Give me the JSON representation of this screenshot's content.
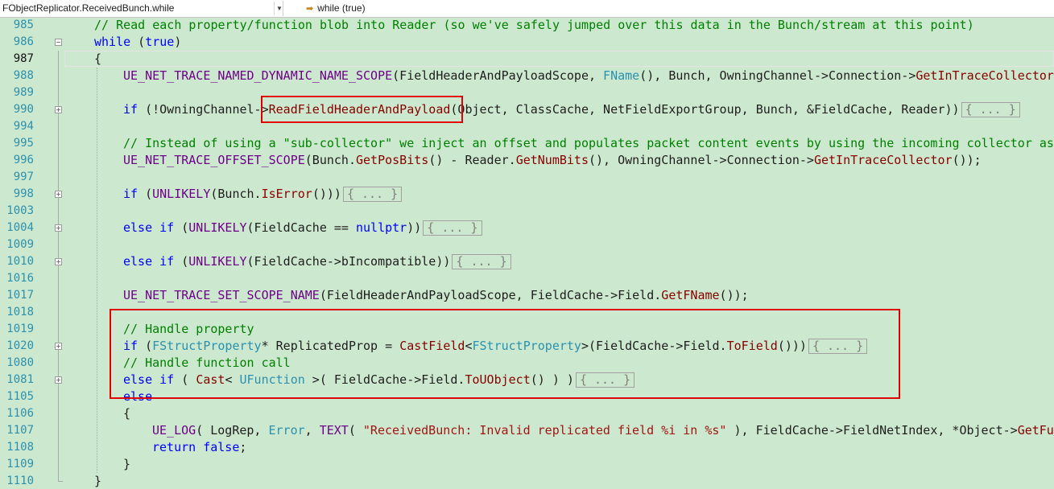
{
  "navigation": {
    "scope_label": "FObjectReplicator.ReceivedBunch.while",
    "member_label": "while (true)"
  },
  "colors": {
    "background": "#cce8cf",
    "line_number": "#2b91af",
    "keyword": "#0000ff",
    "comment": "#008000",
    "macro": "#6f008a",
    "function": "#880000",
    "type": "#2b91af",
    "string": "#a31515",
    "highlight_box": "#e00000"
  },
  "current_line": 987,
  "lines": [
    {
      "num": "985",
      "fold": "none",
      "indent": 0,
      "tokens": [
        {
          "t": "// Read each property/function blob into Reader (so we've safely jumped over this data in the Bunch/stream at this point)",
          "c": "cm"
        }
      ]
    },
    {
      "num": "986",
      "fold": "open",
      "indent": 0,
      "tokens": [
        {
          "t": "while",
          "c": "kw"
        },
        {
          "t": " ("
        },
        {
          "t": "true",
          "c": "kw"
        },
        {
          "t": ")"
        }
      ]
    },
    {
      "num": "987",
      "fold": "none",
      "indent": 0,
      "tokens": [
        {
          "t": "{"
        }
      ]
    },
    {
      "num": "988",
      "fold": "none",
      "indent": 1,
      "tokens": [
        {
          "t": "UE_NET_TRACE_NAMED_DYNAMIC_NAME_SCOPE",
          "c": "mac"
        },
        {
          "t": "(FieldHeaderAndPayloadScope, "
        },
        {
          "t": "FName",
          "c": "ty"
        },
        {
          "t": "(), Bunch, OwningChannel->Connection->"
        },
        {
          "t": "GetInTraceCollector",
          "c": "fn"
        },
        {
          "t": "()"
        }
      ]
    },
    {
      "num": "989",
      "fold": "none",
      "indent": 1,
      "tokens": []
    },
    {
      "num": "990",
      "fold": "closed",
      "indent": 1,
      "tokens": [
        {
          "t": "if",
          "c": "kw"
        },
        {
          "t": " (!OwningChannel->"
        },
        {
          "t": "ReadFieldHeaderAndPayload",
          "c": "fn"
        },
        {
          "t": "(Object, ClassCache, NetFieldExportGroup, Bunch, &FieldCache, Reader))"
        },
        {
          "t": "{ ... }",
          "c": "collapsed"
        }
      ]
    },
    {
      "num": "994",
      "fold": "none",
      "indent": 1,
      "tokens": []
    },
    {
      "num": "995",
      "fold": "none",
      "indent": 1,
      "tokens": [
        {
          "t": "// Instead of using a \"sub-collector\" we inject an offset and populates packet content events by using the incoming collector ass",
          "c": "cm"
        }
      ]
    },
    {
      "num": "996",
      "fold": "none",
      "indent": 1,
      "tokens": [
        {
          "t": "UE_NET_TRACE_OFFSET_SCOPE",
          "c": "mac"
        },
        {
          "t": "(Bunch."
        },
        {
          "t": "GetPosBits",
          "c": "fn"
        },
        {
          "t": "() - Reader."
        },
        {
          "t": "GetNumBits",
          "c": "fn"
        },
        {
          "t": "(), OwningChannel->Connection->"
        },
        {
          "t": "GetInTraceCollector",
          "c": "fn"
        },
        {
          "t": "());"
        }
      ]
    },
    {
      "num": "997",
      "fold": "none",
      "indent": 1,
      "tokens": []
    },
    {
      "num": "998",
      "fold": "closed",
      "indent": 1,
      "tokens": [
        {
          "t": "if",
          "c": "kw"
        },
        {
          "t": " ("
        },
        {
          "t": "UNLIKELY",
          "c": "mac"
        },
        {
          "t": "(Bunch."
        },
        {
          "t": "IsError",
          "c": "fn"
        },
        {
          "t": "()))"
        },
        {
          "t": "{ ... }",
          "c": "collapsed"
        }
      ]
    },
    {
      "num": "1003",
      "fold": "none",
      "indent": 1,
      "tokens": []
    },
    {
      "num": "1004",
      "fold": "closed",
      "indent": 1,
      "tokens": [
        {
          "t": "else",
          "c": "kw"
        },
        {
          "t": " "
        },
        {
          "t": "if",
          "c": "kw"
        },
        {
          "t": " ("
        },
        {
          "t": "UNLIKELY",
          "c": "mac"
        },
        {
          "t": "(FieldCache == "
        },
        {
          "t": "nullptr",
          "c": "kw"
        },
        {
          "t": "))"
        },
        {
          "t": "{ ... }",
          "c": "collapsed"
        }
      ]
    },
    {
      "num": "1009",
      "fold": "none",
      "indent": 1,
      "tokens": []
    },
    {
      "num": "1010",
      "fold": "closed",
      "indent": 1,
      "tokens": [
        {
          "t": "else",
          "c": "kw"
        },
        {
          "t": " "
        },
        {
          "t": "if",
          "c": "kw"
        },
        {
          "t": " ("
        },
        {
          "t": "UNLIKELY",
          "c": "mac"
        },
        {
          "t": "(FieldCache->bIncompatible))"
        },
        {
          "t": "{ ... }",
          "c": "collapsed"
        }
      ]
    },
    {
      "num": "1016",
      "fold": "none",
      "indent": 1,
      "tokens": []
    },
    {
      "num": "1017",
      "fold": "none",
      "indent": 1,
      "tokens": [
        {
          "t": "UE_NET_TRACE_SET_SCOPE_NAME",
          "c": "mac"
        },
        {
          "t": "(FieldHeaderAndPayloadScope, FieldCache->Field."
        },
        {
          "t": "GetFName",
          "c": "fn"
        },
        {
          "t": "());"
        }
      ]
    },
    {
      "num": "1018",
      "fold": "none",
      "indent": 1,
      "tokens": []
    },
    {
      "num": "1019",
      "fold": "none",
      "indent": 1,
      "tokens": [
        {
          "t": "// Handle property",
          "c": "cm"
        }
      ]
    },
    {
      "num": "1020",
      "fold": "closed",
      "indent": 1,
      "tokens": [
        {
          "t": "if",
          "c": "kw"
        },
        {
          "t": " ("
        },
        {
          "t": "FStructProperty",
          "c": "ty"
        },
        {
          "t": "* ReplicatedProp = "
        },
        {
          "t": "CastField",
          "c": "fn"
        },
        {
          "t": "<"
        },
        {
          "t": "FStructProperty",
          "c": "ty"
        },
        {
          "t": ">(FieldCache->Field."
        },
        {
          "t": "ToField",
          "c": "fn"
        },
        {
          "t": "()))"
        },
        {
          "t": "{ ... }",
          "c": "collapsed"
        }
      ]
    },
    {
      "num": "1080",
      "fold": "none",
      "indent": 1,
      "tokens": [
        {
          "t": "// Handle function call",
          "c": "cm"
        }
      ]
    },
    {
      "num": "1081",
      "fold": "closed",
      "indent": 1,
      "tokens": [
        {
          "t": "else",
          "c": "kw"
        },
        {
          "t": " "
        },
        {
          "t": "if",
          "c": "kw"
        },
        {
          "t": " ( "
        },
        {
          "t": "Cast",
          "c": "fn"
        },
        {
          "t": "< "
        },
        {
          "t": "UFunction",
          "c": "ty"
        },
        {
          "t": " >( FieldCache->Field."
        },
        {
          "t": "ToUObject",
          "c": "fn"
        },
        {
          "t": "() ) )"
        },
        {
          "t": "{ ... }",
          "c": "collapsed"
        }
      ]
    },
    {
      "num": "1105",
      "fold": "none",
      "indent": 1,
      "tokens": [
        {
          "t": "else",
          "c": "kw"
        }
      ]
    },
    {
      "num": "1106",
      "fold": "none",
      "indent": 1,
      "tokens": [
        {
          "t": "{"
        }
      ]
    },
    {
      "num": "1107",
      "fold": "none",
      "indent": 2,
      "tokens": [
        {
          "t": "UE_LOG",
          "c": "mac"
        },
        {
          "t": "( LogRep, "
        },
        {
          "t": "Error",
          "c": "ty"
        },
        {
          "t": ", "
        },
        {
          "t": "TEXT",
          "c": "mac"
        },
        {
          "t": "( "
        },
        {
          "t": "\"ReceivedBunch: Invalid replicated field %i in %s\"",
          "c": "st"
        },
        {
          "t": " ), FieldCache->FieldNetIndex, *Object->"
        },
        {
          "t": "GetFul",
          "c": "fn"
        }
      ]
    },
    {
      "num": "1108",
      "fold": "none",
      "indent": 2,
      "tokens": [
        {
          "t": "return",
          "c": "kw"
        },
        {
          "t": " "
        },
        {
          "t": "false",
          "c": "kw"
        },
        {
          "t": ";"
        }
      ]
    },
    {
      "num": "1109",
      "fold": "none",
      "indent": 1,
      "tokens": [
        {
          "t": "}"
        }
      ]
    },
    {
      "num": "1110",
      "fold": "end",
      "indent": 0,
      "tokens": [
        {
          "t": "}"
        }
      ]
    }
  ]
}
